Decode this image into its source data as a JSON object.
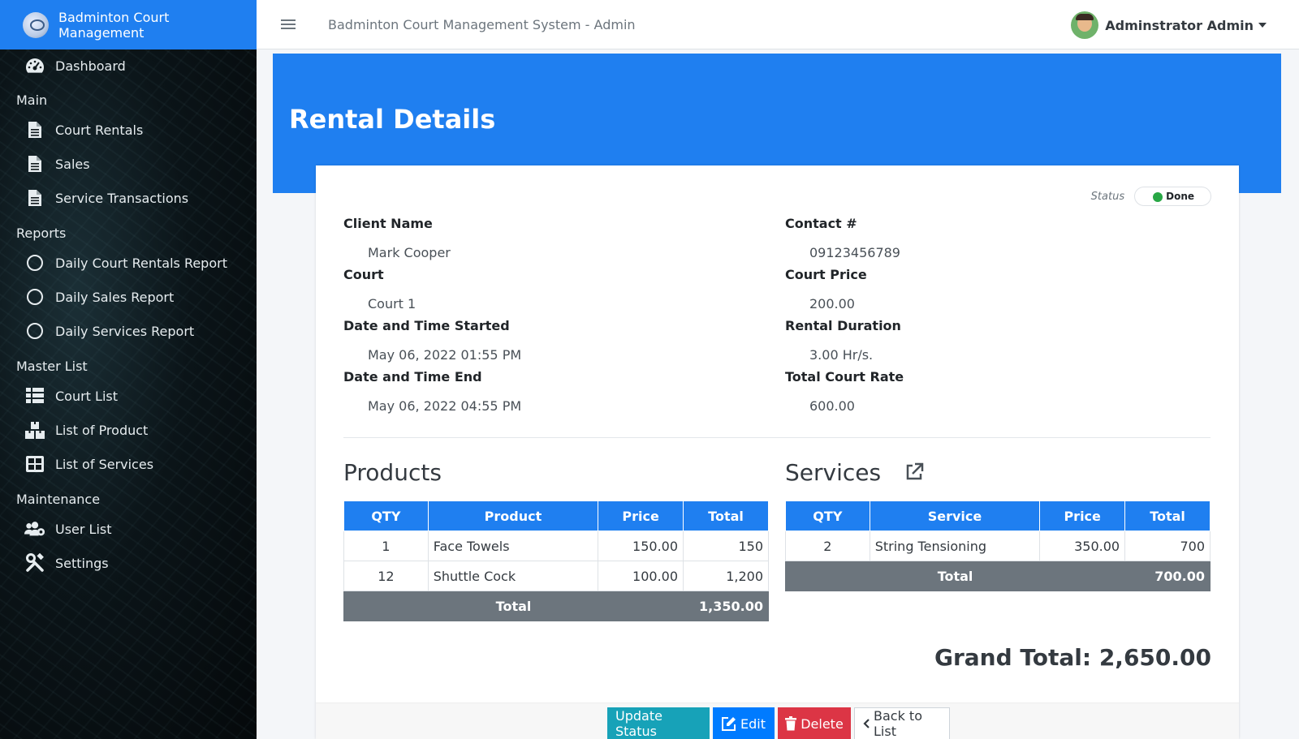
{
  "brand": {
    "name": "Badminton Court Management"
  },
  "topbar": {
    "title": "Badminton Court Management System - Admin",
    "user": "Adminstrator Admin"
  },
  "sidebar": {
    "dashboard": "Dashboard",
    "main_header": "Main",
    "main": [
      "Court Rentals",
      "Sales",
      "Service Transactions"
    ],
    "reports_header": "Reports",
    "reports": [
      "Daily Court Rentals Report",
      "Daily Sales Report",
      "Daily Services Report"
    ],
    "master_header": "Master List",
    "master": [
      "Court List",
      "List of Product",
      "List of Services"
    ],
    "maintenance_header": "Maintenance",
    "maintenance": [
      "User List",
      "Settings"
    ]
  },
  "page": {
    "title": "Rental Details"
  },
  "status": {
    "label": "Status",
    "value": "Done",
    "color": "#28a745"
  },
  "details": {
    "client_name_label": "Client Name",
    "client_name": "Mark Cooper",
    "contact_label": "Contact #",
    "contact": "09123456789",
    "court_label": "Court",
    "court": "Court 1",
    "court_price_label": "Court Price",
    "court_price": "200.00",
    "start_label": "Date and Time Started",
    "start": "May 06, 2022 01:55 PM",
    "duration_label": "Rental Duration",
    "duration": "3.00 Hr/s.",
    "end_label": "Date and Time End",
    "end": "May 06, 2022 04:55 PM",
    "total_rate_label": "Total Court Rate",
    "total_rate": "600.00"
  },
  "products": {
    "title": "Products",
    "headers": [
      "QTY",
      "Product",
      "Price",
      "Total"
    ],
    "rows": [
      {
        "qty": "1",
        "name": "Face Towels",
        "price": "150.00",
        "total": "150"
      },
      {
        "qty": "12",
        "name": "Shuttle Cock",
        "price": "100.00",
        "total": "1,200"
      }
    ],
    "total_label": "Total",
    "total": "1,350.00"
  },
  "services": {
    "title": "Services",
    "headers": [
      "QTY",
      "Service",
      "Price",
      "Total"
    ],
    "rows": [
      {
        "qty": "2",
        "name": "String Tensioning",
        "price": "350.00",
        "total": "700"
      }
    ],
    "total_label": "Total",
    "total": "700.00"
  },
  "grand_total": "Grand Total: 2,650.00",
  "actions": {
    "update": "Update Status",
    "edit": "Edit",
    "delete": "Delete",
    "back": "Back to List"
  },
  "colors": {
    "primary": "#1f7ff0",
    "teal": "#17a2b8",
    "danger": "#dc3545",
    "total_row": "#6c757d"
  }
}
